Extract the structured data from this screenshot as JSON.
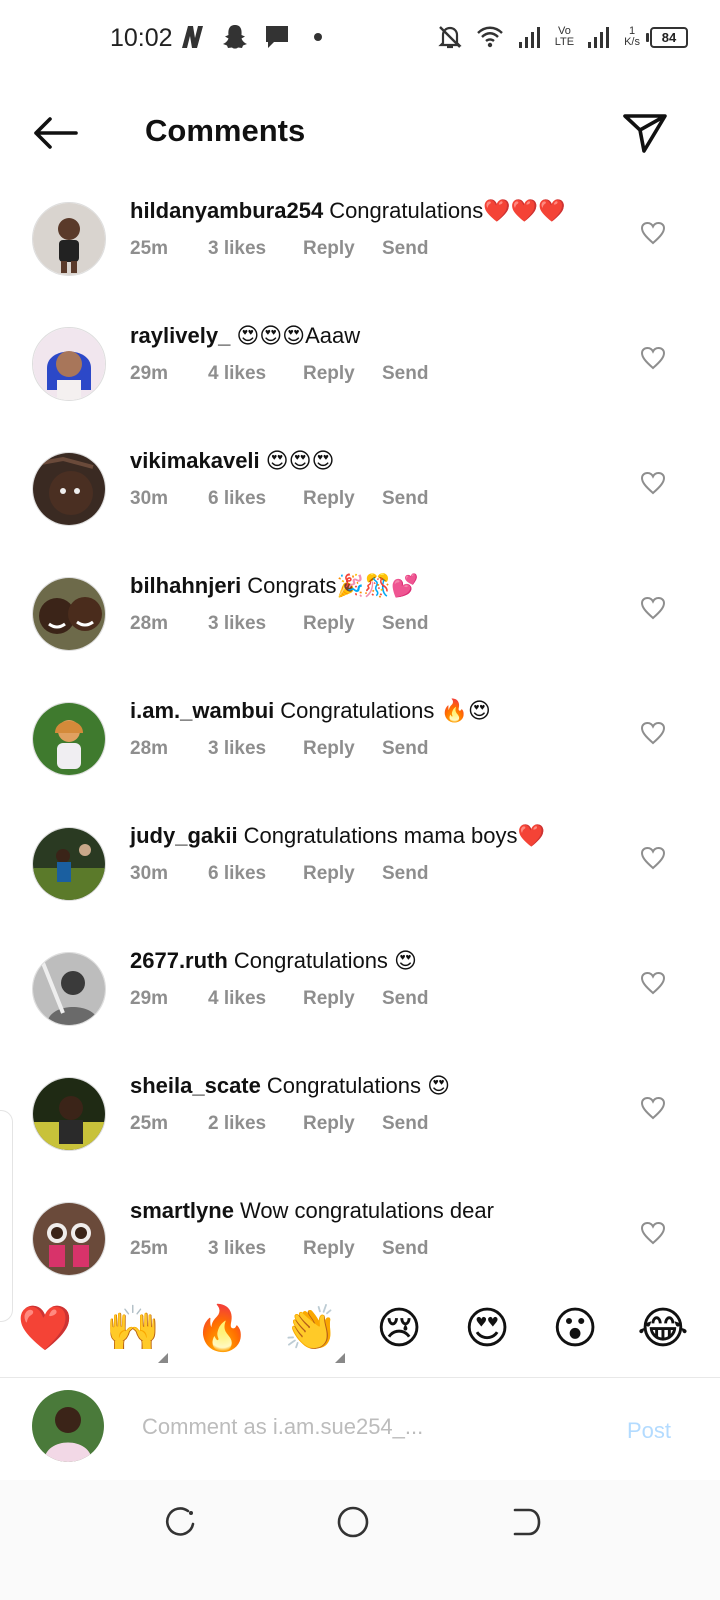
{
  "status_bar": {
    "time": "10:02",
    "network_rate_value": "1",
    "network_rate_unit": "K/s",
    "volte_label_top": "Vo",
    "volte_label_bottom": "LTE",
    "battery": "84"
  },
  "header": {
    "title": "Comments"
  },
  "comments": [
    {
      "username": "hildanyambura254",
      "text": "Congratulations❤️❤️❤️",
      "time": "25m",
      "likes": "3 likes",
      "reply": "Reply",
      "send": "Send"
    },
    {
      "username": "raylively_",
      "text": "😍😍😍Aaaw",
      "time": "29m",
      "likes": "4 likes",
      "reply": "Reply",
      "send": "Send"
    },
    {
      "username": "vikimakaveli",
      "text": "😍😍😍",
      "time": "30m",
      "likes": "6 likes",
      "reply": "Reply",
      "send": "Send"
    },
    {
      "username": "bilhahnjeri",
      "text": "Congrats🎉🎊💕",
      "time": "28m",
      "likes": "3 likes",
      "reply": "Reply",
      "send": "Send"
    },
    {
      "username": "i.am._wambui",
      "text": "Congratulations 🔥😍",
      "time": "28m",
      "likes": "3 likes",
      "reply": "Reply",
      "send": "Send"
    },
    {
      "username": "judy_gakii",
      "text": "Congratulations mama boys❤️",
      "time": "30m",
      "likes": "6 likes",
      "reply": "Reply",
      "send": "Send"
    },
    {
      "username": "2677.ruth",
      "text": "Congratulations 😍",
      "time": "29m",
      "likes": "4 likes",
      "reply": "Reply",
      "send": "Send"
    },
    {
      "username": "sheila_scate",
      "text": "Congratulations 😍",
      "time": "25m",
      "likes": "2 likes",
      "reply": "Reply",
      "send": "Send"
    },
    {
      "username": "smartlyne",
      "text": "Wow congratulations dear",
      "time": "25m",
      "likes": "3 likes",
      "reply": "Reply",
      "send": "Send"
    }
  ],
  "emoji_bar": [
    "❤️",
    "🙌",
    "🔥",
    "👏",
    "😢",
    "😍",
    "😮",
    "😂"
  ],
  "composer": {
    "placeholder": "Comment as i.am.sue254_...",
    "value": "",
    "post_label": "Post"
  },
  "colors": {
    "meta_text": "#8e8e8e",
    "post_disabled": "#b3dbff",
    "placeholder": "#bcbcbc"
  },
  "icons": {
    "back": "arrow-left-icon",
    "share": "paper-plane-icon",
    "like": "heart-outline-icon",
    "nav_recents": "recents-icon",
    "nav_home": "home-circle-icon",
    "nav_back": "back-icon"
  }
}
